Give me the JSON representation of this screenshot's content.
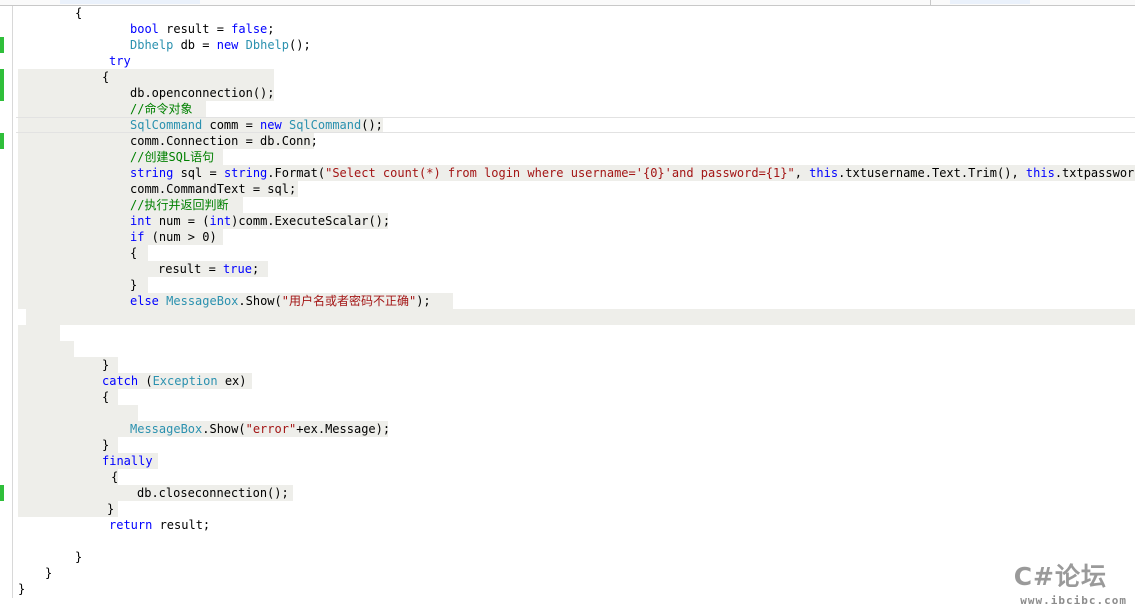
{
  "colors": {
    "keyword": "#0000ff",
    "type": "#2b91af",
    "string": "#a31515",
    "comment": "#008000",
    "change_marker": "#2fbf3a"
  },
  "code_lines": [
    [
      {
        "t": "{",
        "c": "pl"
      }
    ],
    [
      {
        "t": "bool",
        "c": "kw"
      },
      {
        "t": " result = ",
        "c": "pl"
      },
      {
        "t": "false",
        "c": "kw"
      },
      {
        "t": ";",
        "c": "pl"
      }
    ],
    [
      {
        "t": "Dbhelp",
        "c": "ty"
      },
      {
        "t": " db = ",
        "c": "pl"
      },
      {
        "t": "new",
        "c": "kw"
      },
      {
        "t": " ",
        "c": "pl"
      },
      {
        "t": "Dbhelp",
        "c": "ty"
      },
      {
        "t": "();",
        "c": "pl"
      }
    ],
    [
      {
        "t": "try",
        "c": "kw"
      }
    ],
    [
      {
        "t": "{",
        "c": "pl"
      }
    ],
    [
      {
        "t": "db.openconnection();",
        "c": "pl"
      }
    ],
    [
      {
        "t": "//命令对象",
        "c": "cm"
      }
    ],
    [
      {
        "t": "SqlCommand",
        "c": "ty"
      },
      {
        "t": " comm = ",
        "c": "pl"
      },
      {
        "t": "new",
        "c": "kw"
      },
      {
        "t": " ",
        "c": "pl"
      },
      {
        "t": "SqlCommand",
        "c": "ty"
      },
      {
        "t": "();",
        "c": "pl"
      }
    ],
    [
      {
        "t": "comm.Connection = db.Conn;",
        "c": "pl"
      }
    ],
    [
      {
        "t": "//创建SQL语句",
        "c": "cm"
      }
    ],
    [
      {
        "t": "string",
        "c": "kw"
      },
      {
        "t": " sql = ",
        "c": "pl"
      },
      {
        "t": "string",
        "c": "kw"
      },
      {
        "t": ".Format(",
        "c": "pl"
      },
      {
        "t": "\"Select count(*) from login where username='{0}'and password={1}\"",
        "c": "str"
      },
      {
        "t": ", ",
        "c": "pl"
      },
      {
        "t": "this",
        "c": "kw"
      },
      {
        "t": ".txtusername.Text.Trim(), ",
        "c": "pl"
      },
      {
        "t": "this",
        "c": "kw"
      },
      {
        "t": ".txtpassword.Tex",
        "c": "pl"
      }
    ],
    [
      {
        "t": "comm.CommandText = sql;",
        "c": "pl"
      }
    ],
    [
      {
        "t": "//执行并返回判断",
        "c": "cm"
      }
    ],
    [
      {
        "t": "int",
        "c": "kw"
      },
      {
        "t": " num = (",
        "c": "pl"
      },
      {
        "t": "int",
        "c": "kw"
      },
      {
        "t": ")comm.ExecuteScalar();",
        "c": "pl"
      }
    ],
    [
      {
        "t": "if",
        "c": "kw"
      },
      {
        "t": " (num > 0)",
        "c": "pl"
      }
    ],
    [
      {
        "t": "{",
        "c": "pl"
      }
    ],
    [
      {
        "t": "result = ",
        "c": "pl"
      },
      {
        "t": "true",
        "c": "kw"
      },
      {
        "t": ";",
        "c": "pl"
      }
    ],
    [
      {
        "t": "}",
        "c": "pl"
      }
    ],
    [
      {
        "t": "else",
        "c": "kw"
      },
      {
        "t": " ",
        "c": "pl"
      },
      {
        "t": "MessageBox",
        "c": "ty"
      },
      {
        "t": ".Show(",
        "c": "pl"
      },
      {
        "t": "\"用户名或者密码不正确\"",
        "c": "str"
      },
      {
        "t": ");",
        "c": "pl"
      }
    ],
    [
      {
        "t": "}",
        "c": "pl"
      }
    ],
    [
      {
        "t": "catch",
        "c": "kw"
      },
      {
        "t": " (",
        "c": "pl"
      },
      {
        "t": "Exception",
        "c": "ty"
      },
      {
        "t": " ex)",
        "c": "pl"
      }
    ],
    [
      {
        "t": "{",
        "c": "pl"
      }
    ],
    [
      {
        "t": "MessageBox",
        "c": "ty"
      },
      {
        "t": ".Show(",
        "c": "pl"
      },
      {
        "t": "\"error\"",
        "c": "str"
      },
      {
        "t": "+ex.Message);",
        "c": "pl"
      }
    ],
    [
      {
        "t": "}",
        "c": "pl"
      }
    ],
    [
      {
        "t": "finally",
        "c": "kw"
      }
    ],
    [
      {
        "t": "{",
        "c": "pl"
      }
    ],
    [
      {
        "t": "db.closeconnection();",
        "c": "pl"
      }
    ],
    [
      {
        "t": "}",
        "c": "pl"
      }
    ],
    [
      {
        "t": "return",
        "c": "kw"
      },
      {
        "t": " result;",
        "c": "pl"
      }
    ],
    [
      {
        "t": "}",
        "c": "pl"
      }
    ],
    [
      {
        "t": "}",
        "c": "pl"
      }
    ],
    [
      {
        "t": "}",
        "c": "pl"
      }
    ]
  ],
  "watermark": {
    "brand": "C#论坛",
    "url": "www.ibcibc.com"
  }
}
